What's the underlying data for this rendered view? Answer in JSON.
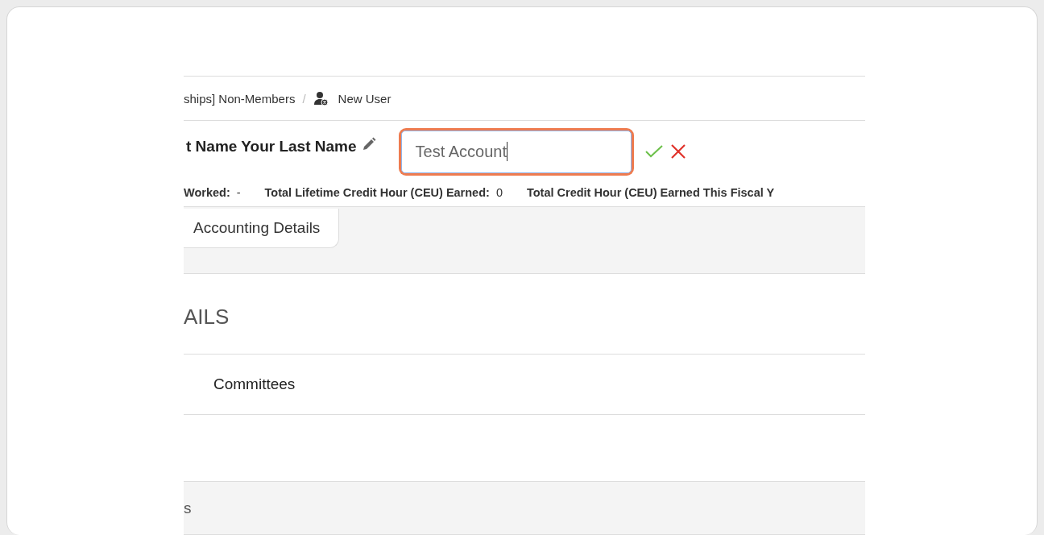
{
  "breadcrumb": {
    "items": [
      {
        "label": "ships] Non-Members"
      },
      {
        "label": "New User"
      }
    ],
    "separator": "/"
  },
  "header": {
    "name": "t Name Your Last Name",
    "edit_field": {
      "value": "Test Account",
      "focused": true
    }
  },
  "stats": [
    {
      "label": "Worked:",
      "value": "-"
    },
    {
      "label": "Total Lifetime Credit Hour (CEU) Earned:",
      "value": "0"
    },
    {
      "label": "Total Credit Hour (CEU) Earned This Fiscal Y"
    }
  ],
  "tabs": [
    {
      "label": "Accounting Details",
      "selected": true
    }
  ],
  "section": {
    "title": "AILS"
  },
  "rows": [
    {
      "kind": "plain",
      "label": "Committees"
    },
    {
      "kind": "empty"
    },
    {
      "kind": "band",
      "label": "s"
    }
  ]
}
